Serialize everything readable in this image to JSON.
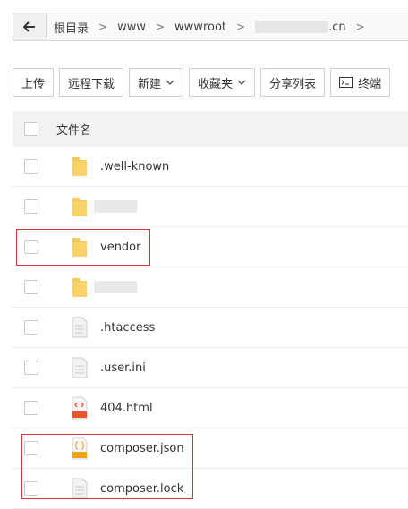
{
  "path": {
    "crumbs": [
      "根目录",
      "www",
      "wwwroot",
      ".cn"
    ]
  },
  "toolbar": {
    "upload": "上传",
    "remote_download": "远程下载",
    "new": "新建",
    "favorites": "收藏夹",
    "share_list": "分享列表",
    "terminal": "终端"
  },
  "table": {
    "header_name": "文件名",
    "rows": [
      {
        "name": ".well-known",
        "type": "folder"
      },
      {
        "name": "",
        "type": "folder"
      },
      {
        "name": "vendor",
        "type": "folder"
      },
      {
        "name": "",
        "type": "folder"
      },
      {
        "name": ".htaccess",
        "type": "file"
      },
      {
        "name": ".user.ini",
        "type": "file"
      },
      {
        "name": "404.html",
        "type": "html"
      },
      {
        "name": "composer.json",
        "type": "json"
      },
      {
        "name": "composer.lock",
        "type": "file"
      }
    ]
  },
  "icons": {
    "back": "arrow-left-icon",
    "folder": "folder-icon",
    "file": "file-icon",
    "html": "html-file-icon",
    "json": "json-file-icon",
    "terminal": "terminal-icon"
  },
  "colors": {
    "folder": "#f5c85a",
    "highlight": "#d9353a",
    "html_badge": "#e8562a",
    "json_badge": "#f0a020"
  }
}
